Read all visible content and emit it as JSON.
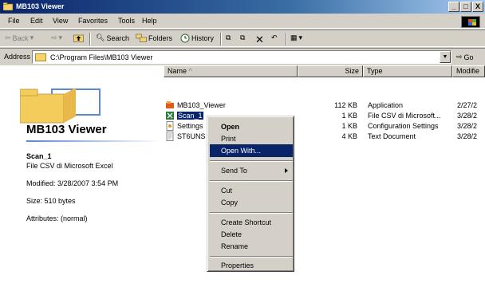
{
  "window": {
    "title": "MB103 Viewer",
    "min": "_",
    "max": "□",
    "close": "X"
  },
  "menu": [
    "File",
    "Edit",
    "View",
    "Favorites",
    "Tools",
    "Help"
  ],
  "toolbar": {
    "back": "Back",
    "search": "Search",
    "folders": "Folders",
    "history": "History"
  },
  "address": {
    "label": "Address",
    "path": "C:\\Program Files\\MB103 Viewer",
    "go": "Go"
  },
  "details": {
    "folder_title": "MB103 Viewer",
    "name": "Scan_1",
    "type": "File CSV di Microsoft Excel",
    "modified": "Modified: 3/28/2007 3:54 PM",
    "size": "Size: 510 bytes",
    "attributes": "Attributes: (normal)"
  },
  "columns": {
    "name": "Name",
    "size": "Size",
    "type": "Type",
    "modified": "Modifie"
  },
  "files": [
    {
      "name": "MB103_Viewer",
      "size": "112 KB",
      "type": "Application",
      "modified": "2/27/2",
      "icon": "application-icon"
    },
    {
      "name": "Scan_1",
      "size": "1 KB",
      "type": "File CSV di Microsoft...",
      "modified": "3/28/2",
      "icon": "excel-csv-icon"
    },
    {
      "name": "Settings",
      "size": "1 KB",
      "type": "Configuration Settings",
      "modified": "3/28/2",
      "icon": "settings-file-icon"
    },
    {
      "name": "ST6UNS",
      "size": "4 KB",
      "type": "Text Document",
      "modified": "3/28/2",
      "icon": "text-document-icon"
    }
  ],
  "context_menu": {
    "open": "Open",
    "print": "Print",
    "open_with": "Open With...",
    "send_to": "Send To",
    "cut": "Cut",
    "copy": "Copy",
    "create_shortcut": "Create Shortcut",
    "delete": "Delete",
    "rename": "Rename",
    "properties": "Properties"
  },
  "colors": {
    "title_start": "#0a246a",
    "title_end": "#a6caf0",
    "face": "#d4d0c8",
    "highlight": "#0a246a"
  }
}
